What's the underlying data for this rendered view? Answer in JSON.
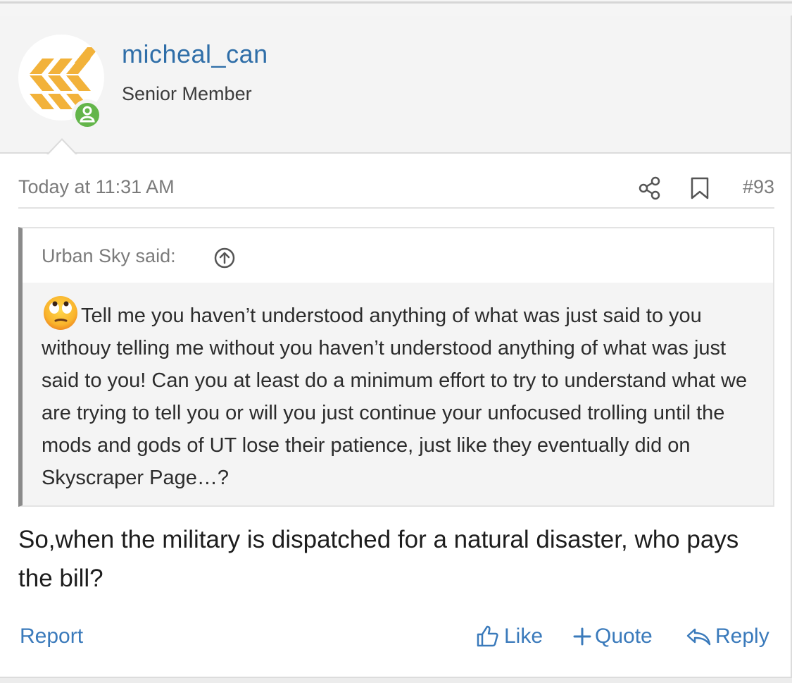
{
  "post": {
    "author": {
      "username": "micheal_can",
      "title": "Senior Member",
      "avatar_icon": "chevron-pattern-avatar",
      "online_icon": "online-user-icon"
    },
    "timestamp": "Today at 11:31 AM",
    "share_icon": "share-icon",
    "bookmark_icon": "bookmark-icon",
    "post_number": "#93",
    "quote": {
      "author_label": "Urban Sky said:",
      "up_icon": "arrow-up-circle-icon",
      "emoji": "eye-roll-emoji",
      "text": "Tell me you haven’t understood anything of what was just said to you withouy telling me without you haven’t understood anything of what was just said to you! Can you at least do a minimum effort to try to understand what we are trying to tell you or will you just continue your unfocused trolling until the mods and gods of UT lose their patience, just like they eventually did on Skyscraper Page…?"
    },
    "message": "So,when the military is dispatched for a natural disaster, who pays the bill?",
    "actions": {
      "report": "Report",
      "like": "Like",
      "quote": "Quote",
      "reply": "Reply"
    }
  },
  "colors": {
    "link": "#3a7abb",
    "username": "#2f6ea8",
    "online": "#63b54a",
    "avatar_accent": "#f2b23a"
  }
}
